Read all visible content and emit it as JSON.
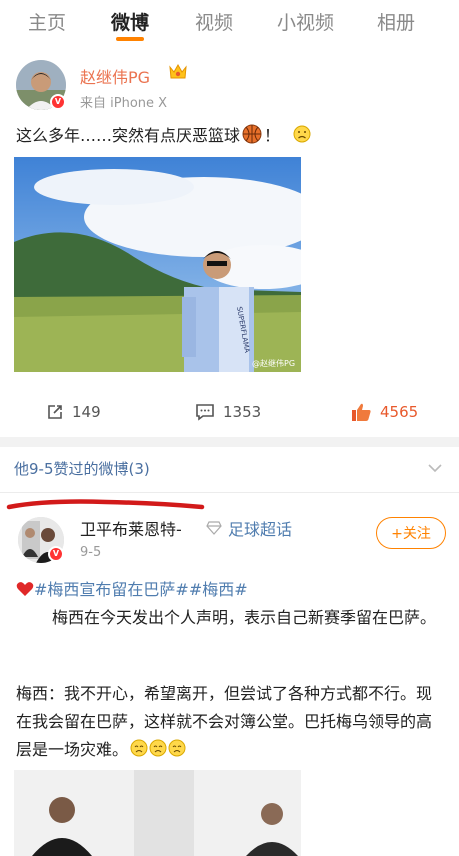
{
  "tabs": [
    "主页",
    "微博",
    "视频",
    "小视频",
    "相册"
  ],
  "post1": {
    "username": "赵继伟PG",
    "source": "来自 iPhone X",
    "text": "这么多年……突然有点厌恶篮球",
    "text_end": "！",
    "photo_watermark": "@赵继伟PG",
    "shirt_text": "SUPERFLAMA",
    "repost_count": "149",
    "comment_count": "1353",
    "like_count": "4565"
  },
  "liked_section": {
    "title": "他9-5赞过的微博(3)"
  },
  "post2": {
    "username": "卫平布莱恩特-",
    "super_topic": "足球超话",
    "date": "9-5",
    "follow_label": "+关注",
    "topics": "#梅西宣布留在巴萨##梅西#",
    "para1": "梅西在今天发出个人声明，表示自己新赛季留在巴萨。",
    "para2": "梅西：我不开心，希望离开，但尝试了各种方式都不行。现在我会留在巴萨，这样就不会对簿公堂。巴托梅乌领导的高层是一场灾难。"
  },
  "colors": {
    "accent": "#ff8200",
    "username": "#eb7350",
    "link": "#507daf",
    "liked": "#e8592c"
  }
}
